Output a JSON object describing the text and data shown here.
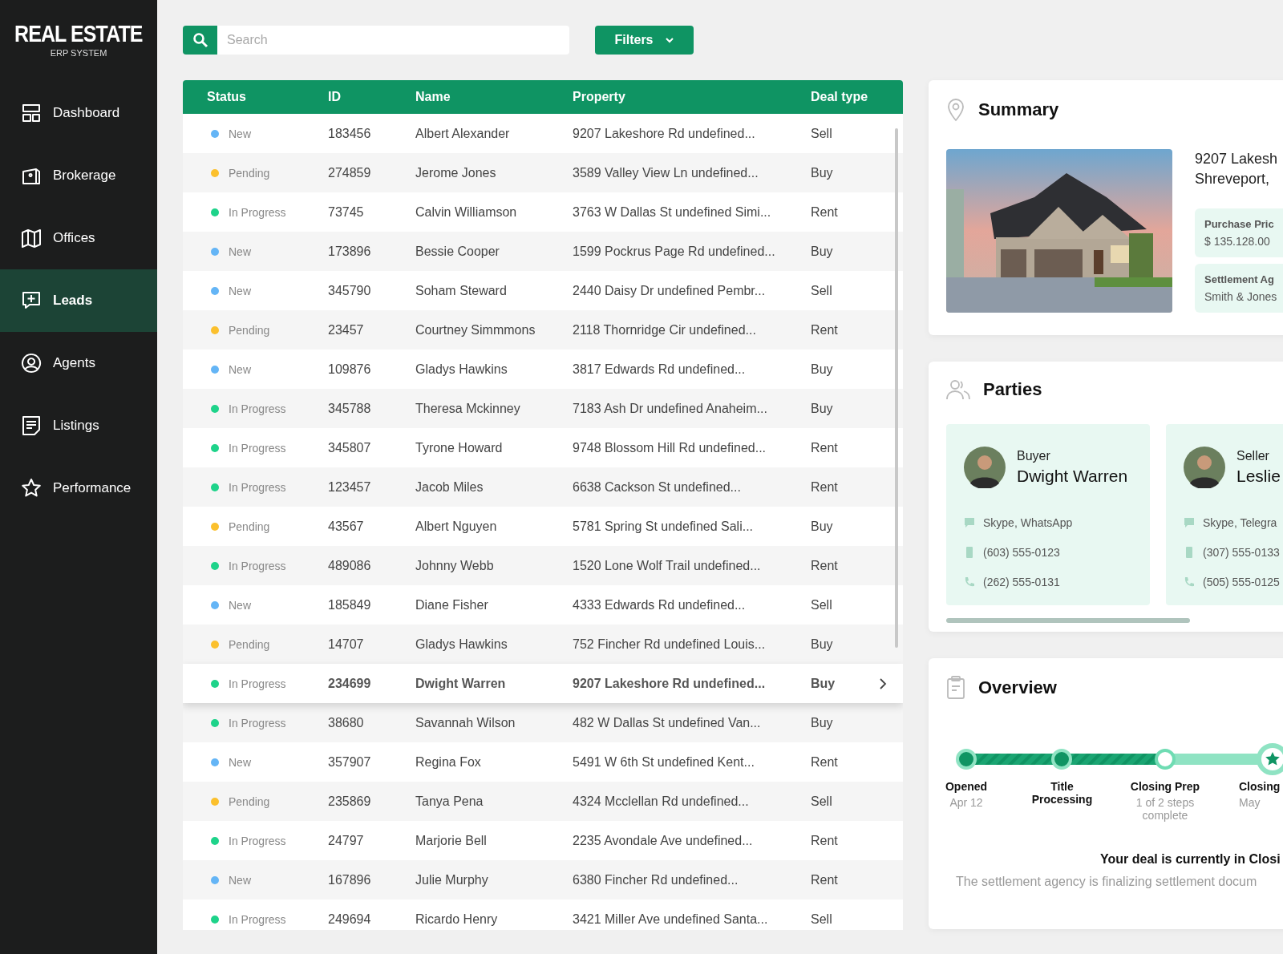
{
  "brand": {
    "title": "REAL ESTATE",
    "subtitle": "ERP SYSTEM"
  },
  "sidebar": {
    "items": [
      {
        "label": "Dashboard",
        "selected": false
      },
      {
        "label": "Brokerage",
        "selected": false
      },
      {
        "label": "Offices",
        "selected": false
      },
      {
        "label": "Leads",
        "selected": true
      },
      {
        "label": "Agents",
        "selected": false
      },
      {
        "label": "Listings",
        "selected": false
      },
      {
        "label": "Performance",
        "selected": false
      }
    ]
  },
  "search": {
    "placeholder": "Search"
  },
  "filters_button": "Filters",
  "table": {
    "columns": [
      "Status",
      "ID",
      "Name",
      "Property",
      "Deal type"
    ],
    "rows": [
      {
        "status": "New",
        "color": "#64b5f6",
        "id": "183456",
        "name": "Albert Alexander",
        "property": "9207 Lakeshore Rd undefined...",
        "deal": "Sell",
        "selected": false
      },
      {
        "status": "Pending",
        "color": "#fbc02d",
        "id": "274859",
        "name": "Jerome Jones",
        "property": "3589 Valley View Ln undefined...",
        "deal": "Buy",
        "selected": false
      },
      {
        "status": "In Progress",
        "color": "#1ed38a",
        "id": "73745",
        "name": "Calvin Williamson",
        "property": "3763 W Dallas St undefined Simi...",
        "deal": "Rent",
        "selected": false
      },
      {
        "status": "New",
        "color": "#64b5f6",
        "id": "173896",
        "name": "Bessie Cooper",
        "property": "1599 Pockrus Page Rd undefined...",
        "deal": "Buy",
        "selected": false
      },
      {
        "status": "New",
        "color": "#64b5f6",
        "id": "345790",
        "name": "Soham Steward",
        "property": "2440 Daisy Dr undefined Pembr...",
        "deal": "Sell",
        "selected": false
      },
      {
        "status": "Pending",
        "color": "#fbc02d",
        "id": "23457",
        "name": "Courtney Simmmons",
        "property": "2118 Thornridge Cir undefined...",
        "deal": "Rent",
        "selected": false
      },
      {
        "status": "New",
        "color": "#64b5f6",
        "id": "109876",
        "name": "Gladys Hawkins",
        "property": "3817 Edwards Rd undefined...",
        "deal": "Buy",
        "selected": false
      },
      {
        "status": "In Progress",
        "color": "#1ed38a",
        "id": "345788",
        "name": "Theresa Mckinney",
        "property": "7183 Ash Dr undefined Anaheim...",
        "deal": "Buy",
        "selected": false
      },
      {
        "status": "In Progress",
        "color": "#1ed38a",
        "id": "345807",
        "name": "Tyrone Howard",
        "property": "9748 Blossom Hill Rd undefined...",
        "deal": "Rent",
        "selected": false
      },
      {
        "status": "In Progress",
        "color": "#1ed38a",
        "id": "123457",
        "name": "Jacob Miles",
        "property": "6638 Cackson St undefined...",
        "deal": "Rent",
        "selected": false
      },
      {
        "status": "Pending",
        "color": "#fbc02d",
        "id": "43567",
        "name": "Albert Nguyen",
        "property": "5781 Spring St undefined Sali...",
        "deal": "Buy",
        "selected": false
      },
      {
        "status": "In Progress",
        "color": "#1ed38a",
        "id": "489086",
        "name": "Johnny Webb",
        "property": "1520 Lone Wolf Trail undefined...",
        "deal": "Rent",
        "selected": false
      },
      {
        "status": "New",
        "color": "#64b5f6",
        "id": "185849",
        "name": "Diane Fisher",
        "property": "4333 Edwards Rd undefined...",
        "deal": "Sell",
        "selected": false
      },
      {
        "status": "Pending",
        "color": "#fbc02d",
        "id": "14707",
        "name": "Gladys Hawkins",
        "property": "752 Fincher Rd undefined Louis...",
        "deal": "Buy",
        "selected": false
      },
      {
        "status": "In Progress",
        "color": "#1ed38a",
        "id": "234699",
        "name": "Dwight Warren",
        "property": "9207 Lakeshore Rd undefined...",
        "deal": "Buy",
        "selected": true
      },
      {
        "status": "In Progress",
        "color": "#1ed38a",
        "id": "38680",
        "name": "Savannah Wilson",
        "property": "482 W Dallas St undefined Van...",
        "deal": "Buy",
        "selected": false
      },
      {
        "status": "New",
        "color": "#64b5f6",
        "id": "357907",
        "name": "Regina Fox",
        "property": "5491 W 6th St undefined Kent...",
        "deal": "Rent",
        "selected": false
      },
      {
        "status": "Pending",
        "color": "#fbc02d",
        "id": "235869",
        "name": "Tanya Pena",
        "property": "4324 Mcclellan Rd undefined...",
        "deal": "Sell",
        "selected": false
      },
      {
        "status": "In Progress",
        "color": "#1ed38a",
        "id": "24797",
        "name": "Marjorie Bell",
        "property": "2235 Avondale Ave undefined...",
        "deal": "Rent",
        "selected": false
      },
      {
        "status": "New",
        "color": "#64b5f6",
        "id": "167896",
        "name": "Julie Murphy",
        "property": "6380 Fincher Rd undefined...",
        "deal": "Rent",
        "selected": false
      },
      {
        "status": "In Progress",
        "color": "#1ed38a",
        "id": "249694",
        "name": "Ricardo Henry",
        "property": "3421 Miller Ave undefined Santa...",
        "deal": "Sell",
        "selected": false
      }
    ]
  },
  "summary": {
    "title": "Summary",
    "picture": {
      "kind": "picture"
    },
    "address": [
      "9207 Lakesh",
      "Shreveport,"
    ],
    "facts": [
      {
        "label": "Purchase Pric",
        "value": "$ 135.128.00"
      },
      {
        "label": "Settlement Ag",
        "value": "Smith & Jones"
      }
    ]
  },
  "parties": {
    "title": "Parties",
    "cards": [
      {
        "role": "Buyer",
        "name": "Dwight Warren",
        "contacts": [
          {
            "kind": "chat",
            "text": "Skype, WhatsApp"
          },
          {
            "kind": "mobile",
            "text": "(603) 555-0123"
          },
          {
            "kind": "phone",
            "text": "(262) 555-0131"
          }
        ]
      },
      {
        "role": "Seller",
        "name": "Leslie",
        "contacts": [
          {
            "kind": "chat",
            "text": "Skype, Telegra"
          },
          {
            "kind": "mobile",
            "text": "(307) 555-0133"
          },
          {
            "kind": "phone",
            "text": "(505) 555-0125"
          }
        ]
      }
    ]
  },
  "overview": {
    "title": "Overview",
    "steps": [
      {
        "kind": "step",
        "label": "Opened",
        "note": "Apr 12",
        "done": true,
        "current": false
      },
      {
        "kind": "step",
        "label": "Title Processing",
        "done": true,
        "current": false
      },
      {
        "kind": "step",
        "label": "Closing Prep",
        "note": "1 of 2 steps complete",
        "done": false,
        "current": true
      },
      {
        "kind": "finish",
        "label": "Closing",
        "note": "May",
        "done": false,
        "current": false
      }
    ],
    "headline": "Your deal is currently in Closi",
    "message": "The settlement agency is finalizing settlement docum"
  }
}
